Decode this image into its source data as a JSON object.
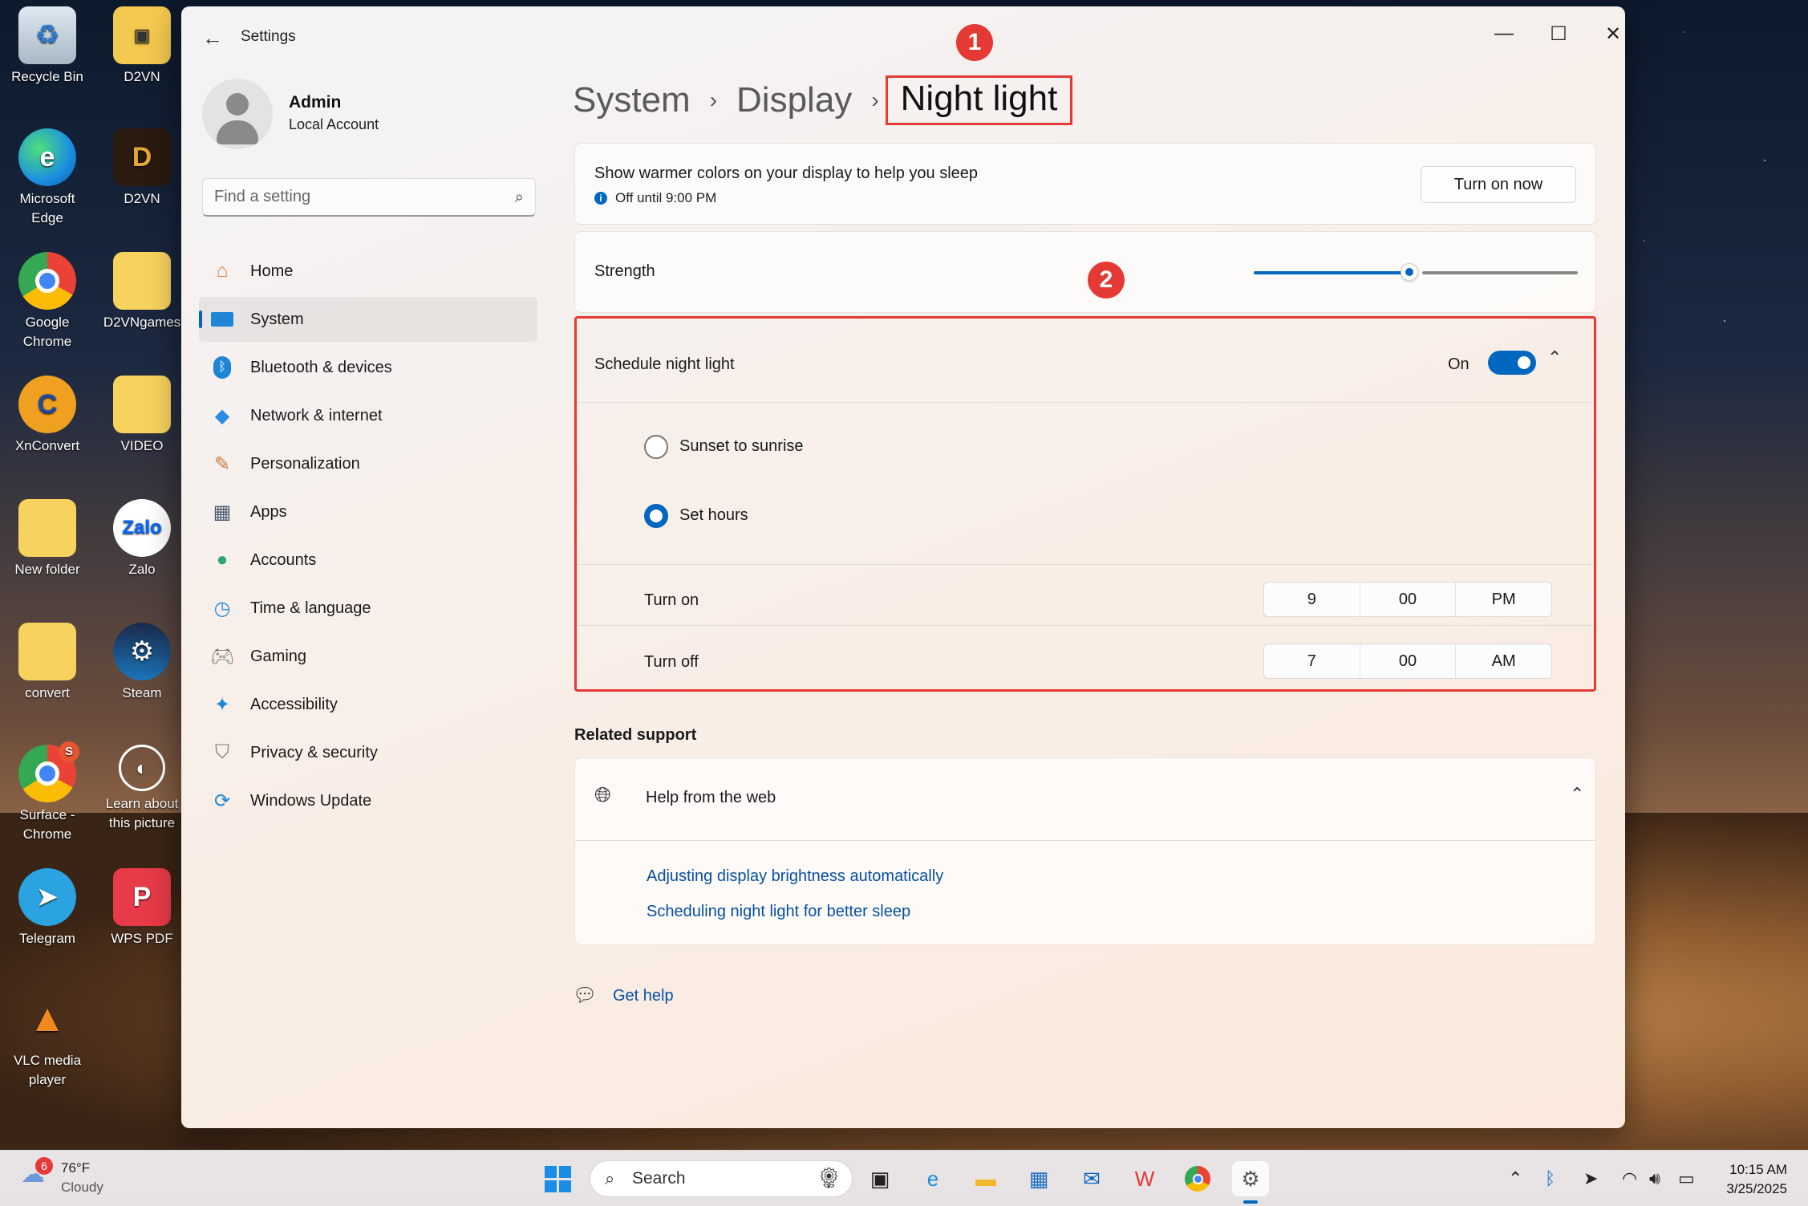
{
  "desktop": {
    "icons": [
      {
        "label": "Recycle Bin",
        "icon": "recycle-bin-icon"
      },
      {
        "label": "D2VN",
        "icon": "folder-icon"
      },
      {
        "label": "Microsoft Edge",
        "icon": "edge-icon"
      },
      {
        "label": "D2VN",
        "icon": "d2vn-game-icon"
      },
      {
        "label": "Google Chrome",
        "icon": "chrome-icon"
      },
      {
        "label": "D2VNgames",
        "icon": "folder-icon"
      },
      {
        "label": "XnConvert",
        "icon": "xnconvert-icon"
      },
      {
        "label": "VIDEO",
        "icon": "folder-icon"
      },
      {
        "label": "New folder",
        "icon": "folder-icon"
      },
      {
        "label": "Zalo",
        "icon": "zalo-icon",
        "glyph": "Zalo"
      },
      {
        "label": "convert",
        "icon": "folder-icon"
      },
      {
        "label": "Steam",
        "icon": "steam-icon"
      },
      {
        "label": "Surface - Chrome",
        "icon": "chrome-profile-icon",
        "badge": "S"
      },
      {
        "label": "Learn about this picture",
        "icon": "learn-picture-icon"
      },
      {
        "label": "Telegram",
        "icon": "telegram-icon"
      },
      {
        "label": "WPS PDF",
        "icon": "wps-pdf-icon"
      },
      {
        "label": "VLC media player",
        "icon": "vlc-icon"
      }
    ]
  },
  "window": {
    "title": "Settings",
    "controls": [
      "minimize",
      "maximize",
      "close"
    ]
  },
  "profile": {
    "name": "Admin",
    "type": "Local Account"
  },
  "search": {
    "placeholder": "Find a setting"
  },
  "nav": {
    "items": [
      {
        "label": "Home",
        "icon": "home-icon"
      },
      {
        "label": "System",
        "icon": "system-icon",
        "active": true
      },
      {
        "label": "Bluetooth & devices",
        "icon": "bluetooth-icon"
      },
      {
        "label": "Network & internet",
        "icon": "network-icon"
      },
      {
        "label": "Personalization",
        "icon": "personalization-icon"
      },
      {
        "label": "Apps",
        "icon": "apps-icon"
      },
      {
        "label": "Accounts",
        "icon": "accounts-icon"
      },
      {
        "label": "Time & language",
        "icon": "time-language-icon"
      },
      {
        "label": "Gaming",
        "icon": "gaming-icon"
      },
      {
        "label": "Accessibility",
        "icon": "accessibility-icon"
      },
      {
        "label": "Privacy & security",
        "icon": "privacy-icon"
      },
      {
        "label": "Windows Update",
        "icon": "windows-update-icon"
      }
    ]
  },
  "breadcrumb": {
    "items": [
      "System",
      "Display"
    ],
    "current": "Night light"
  },
  "markers": [
    "1",
    "2"
  ],
  "night_light": {
    "description": "Show warmer colors on your display to help you sleep",
    "status": "Off until 9:00 PM",
    "turn_on_button": "Turn on now"
  },
  "strength": {
    "label": "Strength",
    "value_fraction": 0.48
  },
  "schedule": {
    "label": "Schedule night light",
    "toggle_state": "On",
    "options": [
      {
        "label": "Sunset to sunrise",
        "checked": false
      },
      {
        "label": "Set hours",
        "checked": true
      }
    ],
    "turn_on": {
      "label": "Turn on",
      "hour": "9",
      "minute": "00",
      "period": "PM"
    },
    "turn_off": {
      "label": "Turn off",
      "hour": "7",
      "minute": "00",
      "period": "AM"
    }
  },
  "related_support": {
    "title": "Related support",
    "help_title": "Help from the web",
    "links": [
      "Adjusting display brightness automatically",
      "Scheduling night light for better sleep"
    ]
  },
  "get_help": "Get help",
  "taskbar": {
    "weather_temp": "76°F",
    "weather_cond": "Cloudy",
    "weather_badge": "6",
    "search_label": "Search",
    "time": "10:15 AM",
    "date": "3/25/2025"
  },
  "colors": {
    "accent": "#0067c0",
    "highlight": "#e53935"
  }
}
